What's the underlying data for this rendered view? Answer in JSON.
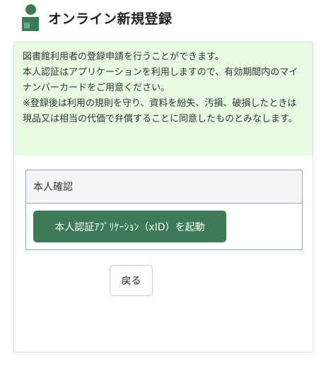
{
  "header": {
    "title": "オンライン新規登録",
    "icon": "user-icon",
    "icon_color": "#3a7a55"
  },
  "notice": {
    "lines": [
      "図書館利用者の登録申請を行うことができます。",
      "本人認証はアプリケーションを利用しますので、有効期間内のマイナンバーカードをご用意ください。",
      "※登録後は利用の規則を守り、資料を紛失、汚損、破損したときは現品又は相当の代価で弁償することに同意したものとみなします。"
    ],
    "background_color": "#e6fbe2"
  },
  "verification": {
    "heading": "本人確認",
    "launch_button_label": "本人認証ｱﾌﾟﾘｹｰｼｮﾝ（xID）を起動",
    "button_color": "#3d7a58"
  },
  "back_button_label": "戻る"
}
